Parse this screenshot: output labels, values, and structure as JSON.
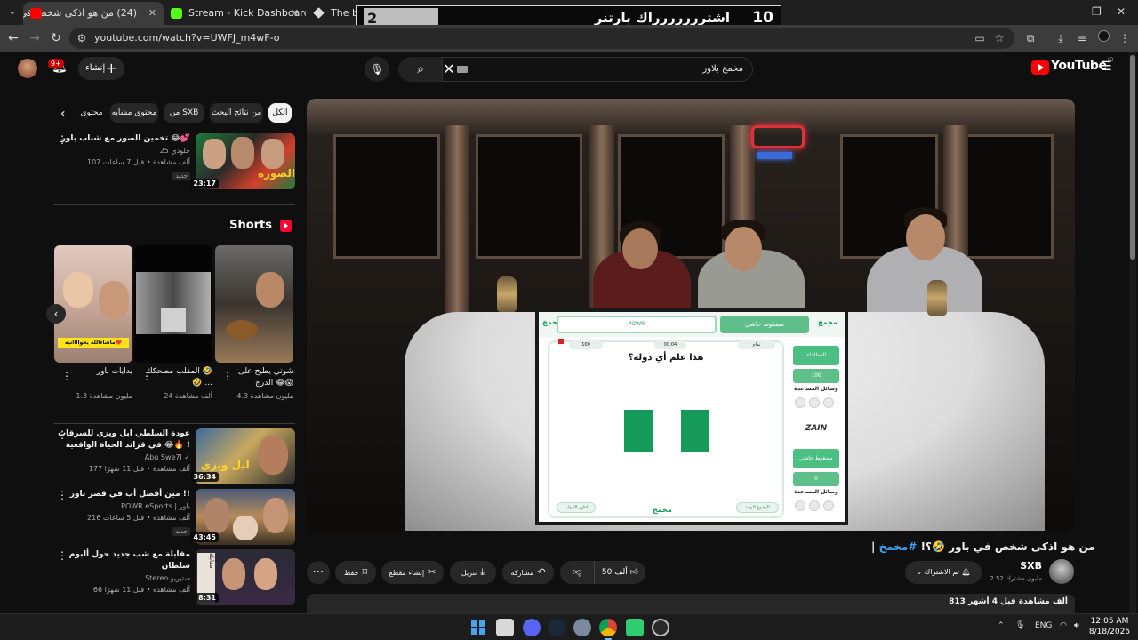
{
  "browser": {
    "tabs": [
      {
        "title": "(24) من هو اذكى شخص في",
        "active": true
      },
      {
        "title": "Stream - Kick Dashboard",
        "active": false
      },
      {
        "title": "The best C",
        "active": false
      }
    ],
    "url": "youtube.com/watch?v=UWFJ_m4wF-o"
  },
  "scoreboard": {
    "left_score": "2",
    "name": "اشتررررررراك بارتنر",
    "right_score": "10"
  },
  "header": {
    "notif_count": "9+",
    "create_label": "إنشاء",
    "search_value": "مخمخ بلاور",
    "logo_text": "YouTube",
    "logo_region": "JO"
  },
  "chips": [
    {
      "label": "الكل",
      "active": true
    },
    {
      "label": "من نتائج البحث",
      "active": false
    },
    {
      "label": "من SXB",
      "active": false
    },
    {
      "label": "محتوى مشابه",
      "active": false
    },
    {
      "label": "محتوى",
      "active": false
    }
  ],
  "related_top": {
    "title": "تخمين الصور مع شباب باور 😂💕",
    "channel": "خلودي 25",
    "stats": "107 ألف مشاهدة • قبل 7 ساعات",
    "new_tag": "جديد",
    "duration": "23:17"
  },
  "shorts": {
    "heading": "Shorts",
    "items": [
      {
        "title": "شوتي يطيح على الدرج 😂😱",
        "stats": "4.3 مليون مشاهدة"
      },
      {
        "title": "المقلب مضحكك 🤣🤣 ...",
        "stats": "24 ألف مشاهدة"
      },
      {
        "title": "بدايات باور",
        "stats": "1.3 مليون مشاهدة"
      }
    ],
    "overlay_text": "ماشاءالله يخوااااتيه❤️"
  },
  "related": [
    {
      "title": "عودة السلطي ابل ويزي للسرقات في قراند الحياة الواقعية 😂🔥 !",
      "channel": "Abu Swe7l",
      "stats": "177 ألف مشاهدة • قبل 11 شهرًا",
      "new_tag": "",
      "duration": "36:34"
    },
    {
      "title": "مين أفضل أب في قصر باور !!",
      "channel": "POWR eSports | باور",
      "stats": "216 ألف مشاهدة • قبل 5 ساعات",
      "new_tag": "جديد",
      "duration": "43:45"
    },
    {
      "title": "مقابلة مع شب جديد حول ألبوم سلطان",
      "channel": "Stereo ستيريو",
      "stats": "66 ألف مشاهدة • قبل 11 شهرًا",
      "new_tag": "",
      "duration": "8:31"
    }
  ],
  "game": {
    "logo": "مخمخ",
    "team_left": "POWR",
    "team_right": "مضغوط حاشي",
    "score_left": "100",
    "timer": "00:04",
    "score_right": "تمام",
    "question": "هذا علم أي دولة؟",
    "btn_reveal": "اظهر الجواب",
    "btn_back": "الرجوع للوحة",
    "side_title": "العطاحلة",
    "side_score_top": "100",
    "help_label": "وسائل المساعدة",
    "sponsor": "ZAIN",
    "side_team_bottom": "مضغوط حاشي",
    "side_score_bottom": "0",
    "help_label_bottom": "وسائل المساعدة",
    "flag_color": "#159a5a"
  },
  "video": {
    "title_hashtag": "#مخمخ",
    "title_text": "| من هو اذكى شخص في باور 🤣؟!",
    "likes": "50 ألف",
    "share": "مشاركة",
    "download": "تنزيل",
    "clip": "إنشاء مقطع",
    "save": "حفظ",
    "subscribe": "تم الاشتراك",
    "channel": "SXB",
    "subscribers": "2.52 مليون مشترك",
    "views_stats": "813 ألف مشاهدة  قبل 4 أشهر"
  },
  "taskbar": {
    "lang": "ENG",
    "time": "12:05 AM",
    "date": "8/18/2025"
  }
}
